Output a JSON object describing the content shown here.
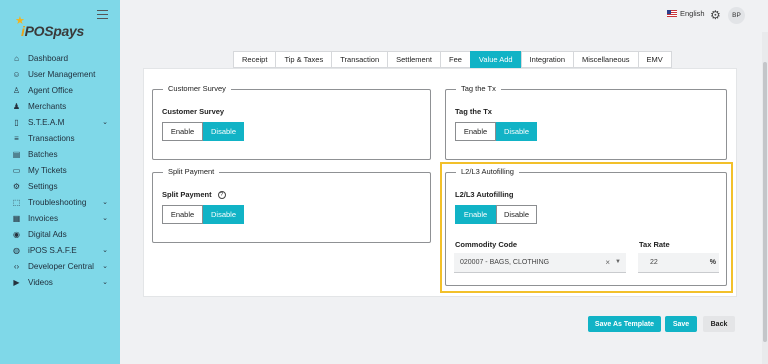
{
  "app": {
    "logo_text": "iPOSpays"
  },
  "sidebar": {
    "items": [
      {
        "label": "Dashboard",
        "icon": "home-icon",
        "glyph": "⌂",
        "caret": false
      },
      {
        "label": "User Management",
        "icon": "user-icon",
        "glyph": "☺",
        "caret": false
      },
      {
        "label": "Agent Office",
        "icon": "agent-icon",
        "glyph": "♙",
        "caret": false
      },
      {
        "label": "Merchants",
        "icon": "merchants-icon",
        "glyph": "♟",
        "caret": false
      },
      {
        "label": "S.T.E.A.M",
        "icon": "phone-icon",
        "glyph": "▯",
        "caret": true
      },
      {
        "label": "Transactions",
        "icon": "transactions-icon",
        "glyph": "≡",
        "caret": false
      },
      {
        "label": "Batches",
        "icon": "batches-icon",
        "glyph": "▤",
        "caret": false
      },
      {
        "label": "My Tickets",
        "icon": "tickets-icon",
        "glyph": "▭",
        "caret": false
      },
      {
        "label": "Settings",
        "icon": "settings-icon",
        "glyph": "⚙",
        "caret": false
      },
      {
        "label": "Troubleshooting",
        "icon": "troubleshooting-icon",
        "glyph": "⬚",
        "caret": true
      },
      {
        "label": "Invoices",
        "icon": "invoices-icon",
        "glyph": "▦",
        "caret": true
      },
      {
        "label": "Digital Ads",
        "icon": "ads-icon",
        "glyph": "◉",
        "caret": false
      },
      {
        "label": "iPOS S.A.F.E",
        "icon": "safe-icon",
        "glyph": "◍",
        "caret": true
      },
      {
        "label": "Developer Central",
        "icon": "code-icon",
        "glyph": "‹›",
        "caret": true
      },
      {
        "label": "Videos",
        "icon": "video-icon",
        "glyph": "▶",
        "caret": true
      }
    ],
    "caret_glyph": "⌄"
  },
  "topbar": {
    "language": "English",
    "avatar_initials": "BP"
  },
  "tabs": [
    "Receipt",
    "Tip & Taxes",
    "Transaction",
    "Settlement",
    "Fee",
    "Value Add",
    "Integration",
    "Miscellaneous",
    "EMV"
  ],
  "active_tab": "Value Add",
  "sections": {
    "customer_survey": {
      "legend": "Customer Survey",
      "label": "Customer Survey",
      "enable": "Enable",
      "disable": "Disable",
      "selected": "Disable"
    },
    "tag_tx": {
      "legend": "Tag the Tx",
      "label": "Tag the Tx",
      "enable": "Enable",
      "disable": "Disable",
      "selected": "Disable"
    },
    "split_payment": {
      "legend": "Split Payment",
      "label": "Split Payment",
      "enable": "Enable",
      "disable": "Disable",
      "selected": "Disable",
      "help": "?"
    },
    "l2l3": {
      "legend": "L2/L3 Autofilling",
      "label": "L2/L3 Autofilling",
      "enable": "Enable",
      "disable": "Disable",
      "selected": "Enable",
      "commodity_label": "Commodity Code",
      "commodity_value": "020007 - BAGS, CLOTHING",
      "tax_label": "Tax Rate",
      "tax_value": "22",
      "tax_unit": "%"
    }
  },
  "actions": {
    "save_template": "Save As Template",
    "save": "Save",
    "back": "Back"
  },
  "colors": {
    "accent": "#11b3c6",
    "sidebar": "#7fd8e8",
    "highlight": "#f2c02a"
  }
}
